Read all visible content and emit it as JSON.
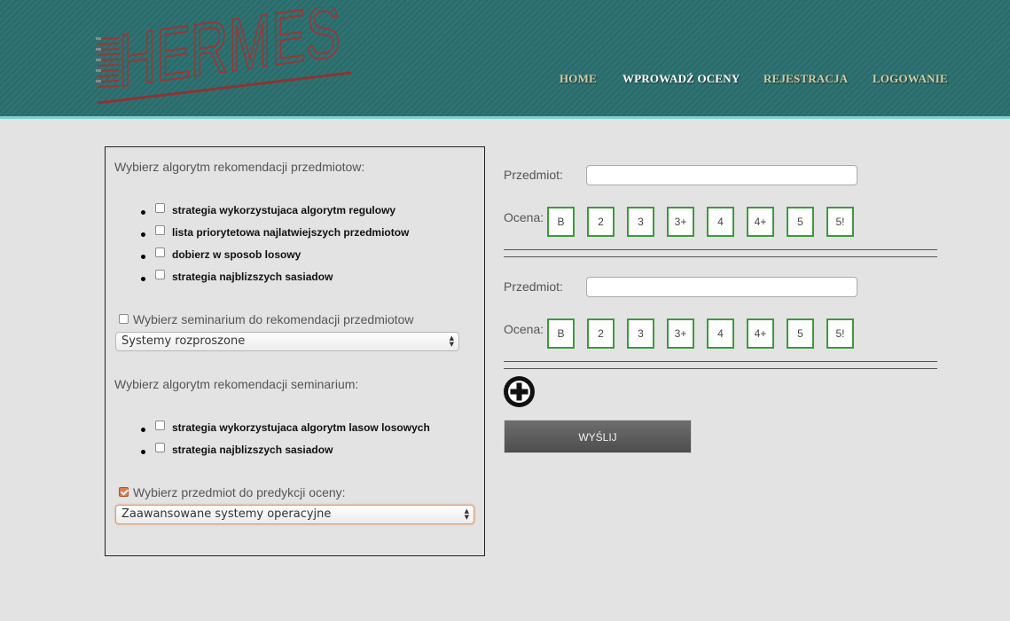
{
  "header": {
    "logo_text": "HERMES",
    "nav": [
      {
        "label": "HOME",
        "active": false
      },
      {
        "label": "WPROWADŹ OCENY",
        "active": true
      },
      {
        "label": "REJESTRACJA",
        "active": false
      },
      {
        "label": "LOGOWANIE",
        "active": false
      }
    ]
  },
  "left_panel": {
    "course_algo_heading": "Wybierz algorytm rekomendacji przedmiotow:",
    "course_algo_options": [
      {
        "label": "strategia wykorzystujaca algorytm regulowy",
        "checked": false
      },
      {
        "label": "lista priorytetowa najlatwiejszych przedmiotow",
        "checked": false
      },
      {
        "label": "dobierz w sposob losowy",
        "checked": false
      },
      {
        "label": "strategia najblizszych sasiadow",
        "checked": false
      }
    ],
    "seminar_checkbox_label": "Wybierz seminarium do rekomendacji przedmiotow",
    "seminar_checked": false,
    "seminar_select_value": "Systemy rozproszone",
    "seminar_algo_heading": "Wybierz algorytm rekomendacji seminarium:",
    "seminar_algo_options": [
      {
        "label": "strategia wykorzystujaca algorytm lasow losowych",
        "checked": false
      },
      {
        "label": "strategia najblizszych sasiadow",
        "checked": false
      }
    ],
    "prediction_checkbox_label": "Wybierz przedmiot do predykcji oceny:",
    "prediction_checked": true,
    "prediction_select_value": "Zaawansowane systemy operacyjne"
  },
  "right_panel": {
    "subject_label": "Przedmiot:",
    "grade_label": "Ocena:",
    "entries": [
      {
        "subject_value": "",
        "grades": [
          "B",
          "2",
          "3",
          "3+",
          "4",
          "4+",
          "5",
          "5!"
        ]
      },
      {
        "subject_value": "",
        "grades": [
          "B",
          "2",
          "3",
          "3+",
          "4",
          "4+",
          "5",
          "5!"
        ]
      }
    ],
    "submit_label": "WYŚLIJ"
  },
  "colors": {
    "header_bg": "#2b6f6e",
    "header_border": "#7fd0cf",
    "nav_text": "#d3cca5",
    "nav_active": "#ffffff",
    "grade_border": "#3c9a3c",
    "checkbox_checked": "#e07a4a",
    "logo_red": "#9b3535",
    "page_bg": "#e3e3e3"
  },
  "icons": {
    "add": "plus-circle-icon",
    "select_arrows": "select-arrows-icon"
  }
}
